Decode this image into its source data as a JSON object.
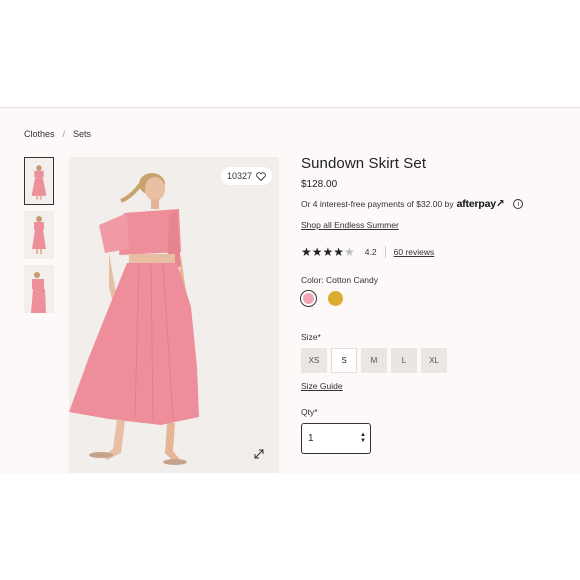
{
  "breadcrumb": {
    "items": [
      "Clothes",
      "Sets"
    ],
    "separator": "/"
  },
  "product": {
    "title": "Sundown Skirt Set",
    "price": "$128.00",
    "likes": "10327",
    "afterpay": {
      "text": "Or 4 interest-free payments of $32.00 by",
      "logo": "afterpay↗",
      "info_icon": "i"
    },
    "shop_link": "Shop all Endless Summer",
    "rating": {
      "stars_text": "★★★★",
      "empty_star": "★",
      "value": "4.2",
      "stars": 4.2,
      "reviews": "60 reviews"
    },
    "color": {
      "label": "Color: Cotton Candy",
      "swatches": [
        {
          "name": "Cotton Candy",
          "hex": "#f2a5b4",
          "selected": true
        },
        {
          "name": "Gold",
          "hex": "#dcac2e",
          "selected": false
        }
      ]
    },
    "size": {
      "label": "Size*",
      "options": [
        "XS",
        "S",
        "M",
        "L",
        "XL"
      ],
      "selected": "S",
      "guide": "Size Guide"
    },
    "qty": {
      "label": "Qty*",
      "value": "1"
    }
  },
  "icons": {
    "heart": "heart-icon",
    "expand": "expand-icon",
    "info": "info-icon",
    "select_arrows": "updown-icon"
  },
  "colors": {
    "dress_pink": "#ee8f9c",
    "background": "#fcf9f8"
  }
}
